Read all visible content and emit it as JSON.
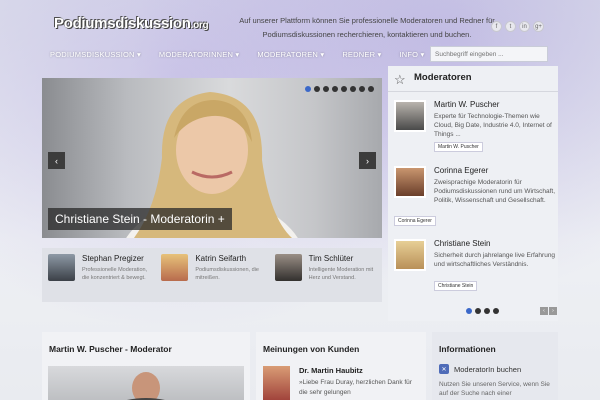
{
  "header": {
    "logo_main": "Podiumsdiskussion",
    "logo_suffix": ".org",
    "tagline": "Auf unserer Plattform können Sie professionelle Moderatoren und Redner für Podiumsdiskussionen recherchieren, kontaktieren und buchen.",
    "social": [
      "f",
      "t",
      "in",
      "g+"
    ]
  },
  "nav": {
    "items": [
      "PODIUMSDISKUSSION",
      "MODERATORINNEN",
      "MODERATOREN",
      "REDNER",
      "INFO"
    ],
    "search_placeholder": "Suchbegriff eingeben ..."
  },
  "slider": {
    "caption": "Christiane Stein - Moderatorin +",
    "dot_count": 8,
    "active_dot": 0,
    "prev": "‹",
    "next": "›"
  },
  "mini_row": [
    {
      "name": "Stephan Pregizer",
      "desc": "Professionelle Moderation, die konzentriert & bewegt."
    },
    {
      "name": "Katrin Seifarth",
      "desc": "Podiumsdiskussionen, die mitreißen."
    },
    {
      "name": "Tim Schlüter",
      "desc": "Intelligente Moderation mit Herz und Verstand."
    }
  ],
  "sidebar": {
    "title": "Moderatoren",
    "cards": [
      {
        "name": "Martin W. Puscher",
        "desc": "Experte für Technologie-Themen wie Cloud, Big Date, Industrie 4.0, Internet of Things ...",
        "tag": "Martin W. Puscher"
      },
      {
        "name": "Corinna Egerer",
        "desc": "Zweisprachige Moderatorin für Podiumsdiskussionen rund um Wirtschaft, Politik, Wissenschaft und Gesellschaft.",
        "tag": "Corinna Egerer"
      },
      {
        "name": "Christiane Stein",
        "desc": "Sicherheit durch jahrelange live Erfahrung und wirtschaftliches Verständnis.",
        "tag": "Christiane Stein"
      }
    ],
    "dot_count": 4,
    "active_dot": 0
  },
  "panels": {
    "moderator_title": "Martin W. Puscher - Moderator",
    "kunden_title": "Meinungen von Kunden",
    "quote_name": "Dr. Martin Haubitz",
    "quote_text": "»Liebe Frau Duray, herzlichen Dank für die sehr gelungen",
    "info_title": "Informationen",
    "info_link": "ModeratorIn buchen",
    "info_text": "Nutzen Sie unseren Service, wenn Sie auf der Suche nach einer"
  },
  "colors": {
    "accent": "#3b68c9",
    "panel": "#f1f2f5"
  }
}
